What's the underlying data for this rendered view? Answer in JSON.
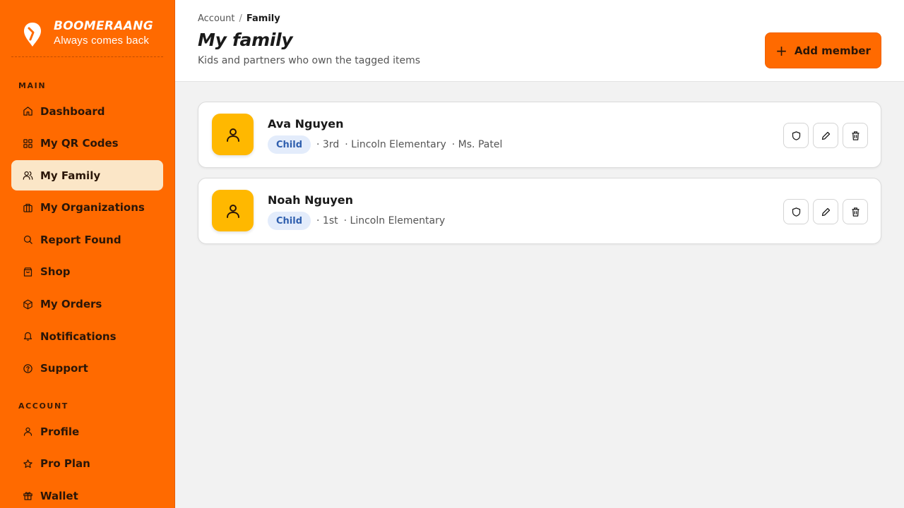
{
  "brand": {
    "name": "BOOMERAANG",
    "tagline": "Always comes back"
  },
  "sidebar": {
    "main_label": "MAIN",
    "account_label": "ACCOUNT",
    "main_items": [
      {
        "label": "Dashboard",
        "icon": "home-icon"
      },
      {
        "label": "My QR Codes",
        "icon": "grid-icon"
      },
      {
        "label": "My Family",
        "icon": "users-icon",
        "active": true
      },
      {
        "label": "My Organizations",
        "icon": "briefcase-icon"
      },
      {
        "label": "Report Found",
        "icon": "search-icon"
      },
      {
        "label": "Shop",
        "icon": "shopping-bag-icon"
      },
      {
        "label": "My Orders",
        "icon": "package-icon"
      },
      {
        "label": "Notifications",
        "icon": "bell-icon"
      },
      {
        "label": "Support",
        "icon": "help-circle-icon"
      }
    ],
    "account_items": [
      {
        "label": "Profile",
        "icon": "user-icon"
      },
      {
        "label": "Pro Plan",
        "icon": "star-icon"
      },
      {
        "label": "Wallet",
        "icon": "gift-icon"
      }
    ]
  },
  "header": {
    "breadcrumb": [
      "Account",
      "Family"
    ],
    "breadcrumb_sep": "/",
    "title": "My family",
    "subtitle": "Kids and partners who own the tagged items",
    "add_button": "Add member",
    "add_button_icon": "+"
  },
  "members": [
    {
      "name": "Ava Nguyen",
      "role": "Child",
      "details": [
        "3rd",
        "Lincoln Elementary",
        "Ms. Patel"
      ]
    },
    {
      "name": "Noah Nguyen",
      "role": "Child",
      "details": [
        "1st",
        "Lincoln Elementary"
      ]
    }
  ],
  "colors": {
    "accent": "#ff6a00",
    "avatar": "#ffb800",
    "active_nav": "#fbe6c7",
    "badge_bg": "#e3ecfb",
    "badge_text": "#2f5fae"
  }
}
